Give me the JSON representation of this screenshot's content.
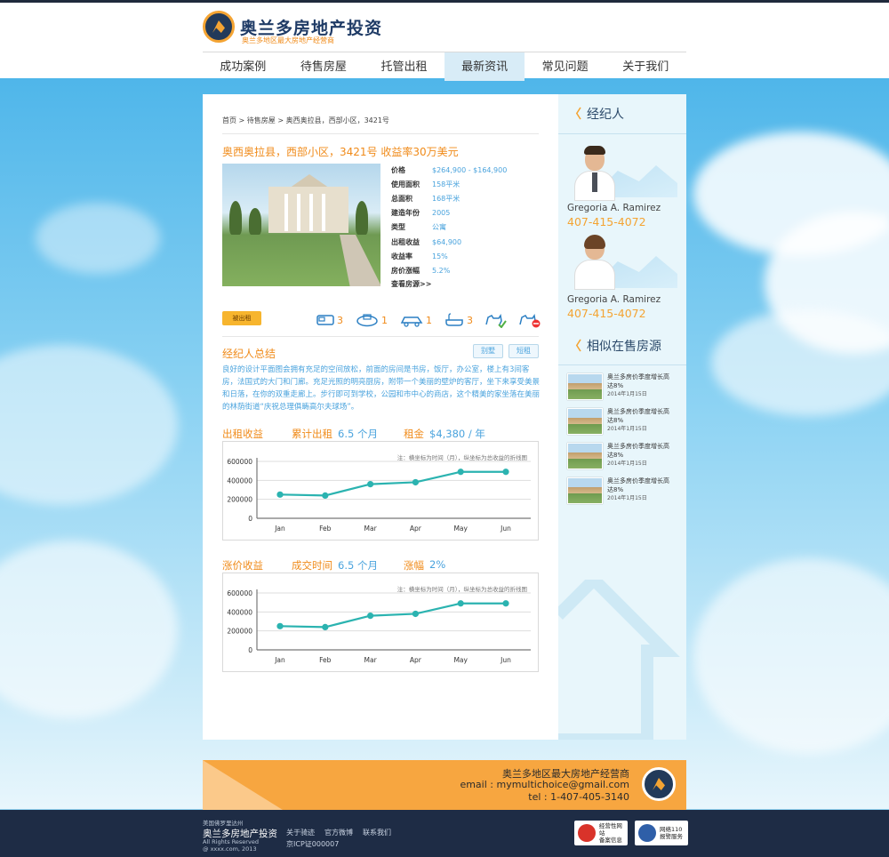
{
  "brand": {
    "title": "奥兰多房地产投资",
    "subtitle": "奥兰多地区最大房地产经营商"
  },
  "nav": [
    "成功案例",
    "待售房屋",
    "托管出租",
    "最新资讯",
    "常见问题",
    "关于我们"
  ],
  "breadcrumb": "首页 > 待售房屋 > 奥西奥拉县，西部小区，3421号",
  "property": {
    "title": "奥西奥拉县，西部小区，3421号  收益率30万美元",
    "specs": [
      {
        "k": "价格",
        "v": "$264,900 - $164,900"
      },
      {
        "k": "使用面积",
        "v": "158平米"
      },
      {
        "k": "总面积",
        "v": "168平米"
      },
      {
        "k": "建造年份",
        "v": "2005"
      },
      {
        "k": "类型",
        "v": "公寓"
      },
      {
        "k": "出租收益",
        "v": "$64,900"
      },
      {
        "k": "收益率",
        "v": "15%"
      },
      {
        "k": "房价涨幅",
        "v": "5.2%"
      }
    ],
    "more_link": "查看房源>>",
    "tag": "被出租",
    "features": [
      "3",
      "1",
      "1",
      "3"
    ]
  },
  "summary": {
    "title": "经纪人总结",
    "btn1": "别墅",
    "btn2": "短租",
    "text": "良好的设计平面图会拥有充足的空间放松，前面的房间是书房，饭厅，办公室，楼上有3间客房，法国式的大门和门廊。充足光照的明亮厨房，附带一个美丽的壁炉的客厅，坐下来享受美景和日落，在你的双重走廊上。步行即可到学校，公园和市中心的商店，这个精美的家坐落在美丽的林荫街道“庆祝总理俱畴高尔夫球场”。"
  },
  "rental": {
    "l1": "出租收益",
    "l2": "累计出租",
    "v2": "6.5 个月",
    "l3": "租金",
    "v3": "$4,380 / 年"
  },
  "appreciation": {
    "l1": "涨价收益",
    "l2": "成交时间",
    "v2": "6.5 个月",
    "l3": "涨幅",
    "v3": "2%"
  },
  "chart_note": "注：横坐标为时间（月），纵坐标为总收益的折线图",
  "chart_data": [
    {
      "type": "line",
      "categories": [
        "Jan",
        "Feb",
        "Mar",
        "Apr",
        "May",
        "Jun"
      ],
      "values": [
        250000,
        240000,
        360000,
        380000,
        490000,
        490000
      ],
      "yticks": [
        "0",
        "200000",
        "400000",
        "600000"
      ],
      "ylim": [
        0,
        600000
      ]
    },
    {
      "type": "line",
      "categories": [
        "Jan",
        "Feb",
        "Mar",
        "Apr",
        "May",
        "Jun"
      ],
      "values": [
        250000,
        240000,
        360000,
        380000,
        490000,
        490000
      ],
      "yticks": [
        "0",
        "200000",
        "400000",
        "600000"
      ],
      "ylim": [
        0,
        600000
      ]
    }
  ],
  "sidebar": {
    "agents_title": "经纪人",
    "agents": [
      {
        "name": "Gregoria A. Ramirez",
        "phone": "407-415-4072"
      },
      {
        "name": "Gregoria A. Ramirez",
        "phone": "407-415-4072"
      }
    ],
    "similar_title": "相似在售房源",
    "similar": [
      {
        "title": "奥兰多房价季度增长高达8%",
        "date": "2014年1月15日"
      },
      {
        "title": "奥兰多房价季度增长高达8%",
        "date": "2014年1月15日"
      },
      {
        "title": "奥兰多房价季度增长高达8%",
        "date": "2014年1月15日"
      },
      {
        "title": "奥兰多房价季度增长高达8%",
        "date": "2014年1月15日"
      }
    ]
  },
  "footer": {
    "line1": "奥兰多地区最大房地产经营商",
    "line2": "email : mymultichoice@gmail.com",
    "line3": "tel : 1-407-405-3140"
  },
  "bottom": {
    "small1": "美国佛罗里达州",
    "name": "奥兰多房地产投资",
    "small2": "All Rights Reserved",
    "small3": "@ xxxx.com, 2013",
    "links": [
      "关于骑迹",
      "官方微博",
      "联系我们"
    ],
    "icp": "京ICP证000007",
    "badge1": [
      "经营性网站",
      "备案信息"
    ],
    "badge2": [
      "网络110",
      "报警服务"
    ]
  }
}
